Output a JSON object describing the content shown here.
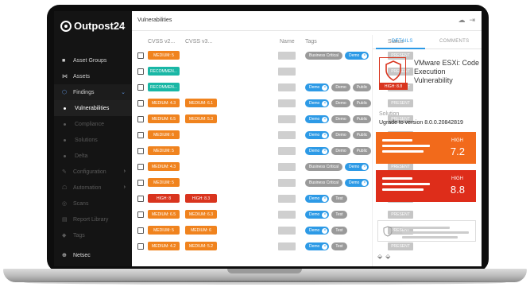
{
  "app": {
    "brand": "Outpost24"
  },
  "topbar": {
    "title": "Vulnerabilities"
  },
  "sidebar": {
    "items": [
      {
        "label": "Asset Groups",
        "icon": "folder-icon"
      },
      {
        "label": "Assets",
        "icon": "network-icon"
      },
      {
        "label": "Findings",
        "icon": "shield-icon"
      },
      {
        "label": "Vulnerabilities"
      },
      {
        "label": "Compliance"
      },
      {
        "label": "Solutions"
      },
      {
        "label": "Delta"
      },
      {
        "label": "Configuration",
        "icon": "wrench-icon"
      },
      {
        "label": "Automation",
        "icon": "robot-icon"
      },
      {
        "label": "Scans",
        "icon": "scan-icon"
      },
      {
        "label": "Report Library",
        "icon": "report-icon"
      },
      {
        "label": "Tags",
        "icon": "tag-icon"
      }
    ],
    "footer": {
      "label": "Netsec",
      "icon": "plus-circle-icon"
    }
  },
  "table": {
    "headers": {
      "cvss2": "CVSS v2...",
      "cvss3": "CVSS v3...",
      "name": "Name",
      "tags": "Tags",
      "status": "Status"
    },
    "rows": [
      {
        "cvss2": "MEDIUM: 5",
        "cvss2_color": "orange",
        "cvss3": "",
        "cvss3_color": "",
        "tags": [
          {
            "t": "Business Critical",
            "c": "gray"
          },
          {
            "t": "Demo",
            "c": "blue"
          }
        ],
        "status": "PRESENT"
      },
      {
        "cvss2": "RECOMMEN...",
        "cvss2_color": "teal",
        "cvss3": "",
        "cvss3_color": "",
        "tags": [],
        "status": "PRESENT"
      },
      {
        "cvss2": "RECOMMEN...",
        "cvss2_color": "teal",
        "cvss3": "",
        "cvss3_color": "",
        "tags": [
          {
            "t": "Demo",
            "c": "blue"
          },
          {
            "t": "Demo",
            "c": "gray"
          },
          {
            "t": "Public",
            "c": "gray"
          }
        ],
        "status": "PRESENT"
      },
      {
        "cvss2": "MEDIUM: 4.3",
        "cvss2_color": "orange",
        "cvss3": "MEDIUM: 6.1",
        "cvss3_color": "orange",
        "tags": [
          {
            "t": "Demo",
            "c": "blue"
          },
          {
            "t": "Demo",
            "c": "gray"
          },
          {
            "t": "Public",
            "c": "gray"
          }
        ],
        "status": "PRESENT"
      },
      {
        "cvss2": "MEDIUM: 6.5",
        "cvss2_color": "orange",
        "cvss3": "MEDIUM: 5.3",
        "cvss3_color": "orange",
        "tags": [
          {
            "t": "Demo",
            "c": "blue"
          },
          {
            "t": "Demo",
            "c": "gray"
          },
          {
            "t": "Public",
            "c": "gray"
          }
        ],
        "status": "PRESENT"
      },
      {
        "cvss2": "MEDIUM: 6",
        "cvss2_color": "orange",
        "cvss3": "",
        "cvss3_color": "",
        "tags": [
          {
            "t": "Demo",
            "c": "blue"
          },
          {
            "t": "Demo",
            "c": "gray"
          },
          {
            "t": "Public",
            "c": "gray"
          }
        ],
        "status": "PRESENT"
      },
      {
        "cvss2": "MEDIUM: 5",
        "cvss2_color": "orange",
        "cvss3": "",
        "cvss3_color": "",
        "tags": [
          {
            "t": "Demo",
            "c": "blue"
          },
          {
            "t": "Demo",
            "c": "gray"
          },
          {
            "t": "Public",
            "c": "gray"
          }
        ],
        "status": "PRESENT"
      },
      {
        "cvss2": "MEDIUM: 4.3",
        "cvss2_color": "orange",
        "cvss3": "",
        "cvss3_color": "",
        "tags": [
          {
            "t": "Business Critical",
            "c": "gray"
          },
          {
            "t": "Demo",
            "c": "blue"
          }
        ],
        "status": "PRESENT"
      },
      {
        "cvss2": "MEDIUM: 5",
        "cvss2_color": "orange",
        "cvss3": "",
        "cvss3_color": "",
        "tags": [
          {
            "t": "Business Critical",
            "c": "gray"
          },
          {
            "t": "Demo",
            "c": "blue"
          }
        ],
        "status": "PRESENT"
      },
      {
        "cvss2": "HIGH: 8",
        "cvss2_color": "red",
        "cvss3": "HIGH: 8.3",
        "cvss3_color": "red",
        "tags": [
          {
            "t": "Demo",
            "c": "blue"
          },
          {
            "t": "Test",
            "c": "gray"
          }
        ],
        "status": "PRESENT"
      },
      {
        "cvss2": "MEDIUM: 6.5",
        "cvss2_color": "orange",
        "cvss3": "MEDIUM: 6.3",
        "cvss3_color": "orange",
        "tags": [
          {
            "t": "Demo",
            "c": "blue"
          },
          {
            "t": "Test",
            "c": "gray"
          }
        ],
        "status": "PRESENT"
      },
      {
        "cvss2": "MEDIUM: 5",
        "cvss2_color": "orange",
        "cvss3": "MEDIUM: 6",
        "cvss3_color": "orange",
        "tags": [
          {
            "t": "Demo",
            "c": "blue"
          },
          {
            "t": "Test",
            "c": "gray"
          }
        ],
        "status": "PRESENT"
      },
      {
        "cvss2": "MEDIUM: 4.2",
        "cvss2_color": "orange",
        "cvss3": "MEDIUM: 5.2",
        "cvss3_color": "orange",
        "tags": [
          {
            "t": "Demo",
            "c": "blue"
          },
          {
            "t": "Test",
            "c": "gray"
          }
        ],
        "status": "PRESENT"
      }
    ]
  },
  "panel": {
    "tabs": {
      "details": "DETAILS",
      "comments": "COMMENTS"
    },
    "severity_chip": "HIGH: 8.8",
    "title": "VMware ESXi: Code Execution Vulnerability",
    "solution_label": "Solution",
    "solution_text": "Ugrade to version 8.0.0.20842819",
    "cards": [
      {
        "severity": "HIGH",
        "score": "7.2",
        "color": "#f26a1b"
      },
      {
        "severity": "HIGH",
        "score": "8.8",
        "color": "#de2d1a"
      }
    ]
  },
  "colors": {
    "accent": "#2d9ae6",
    "medium": "#f0831e",
    "recommended": "#19b7a5",
    "high": "#d9341e"
  }
}
